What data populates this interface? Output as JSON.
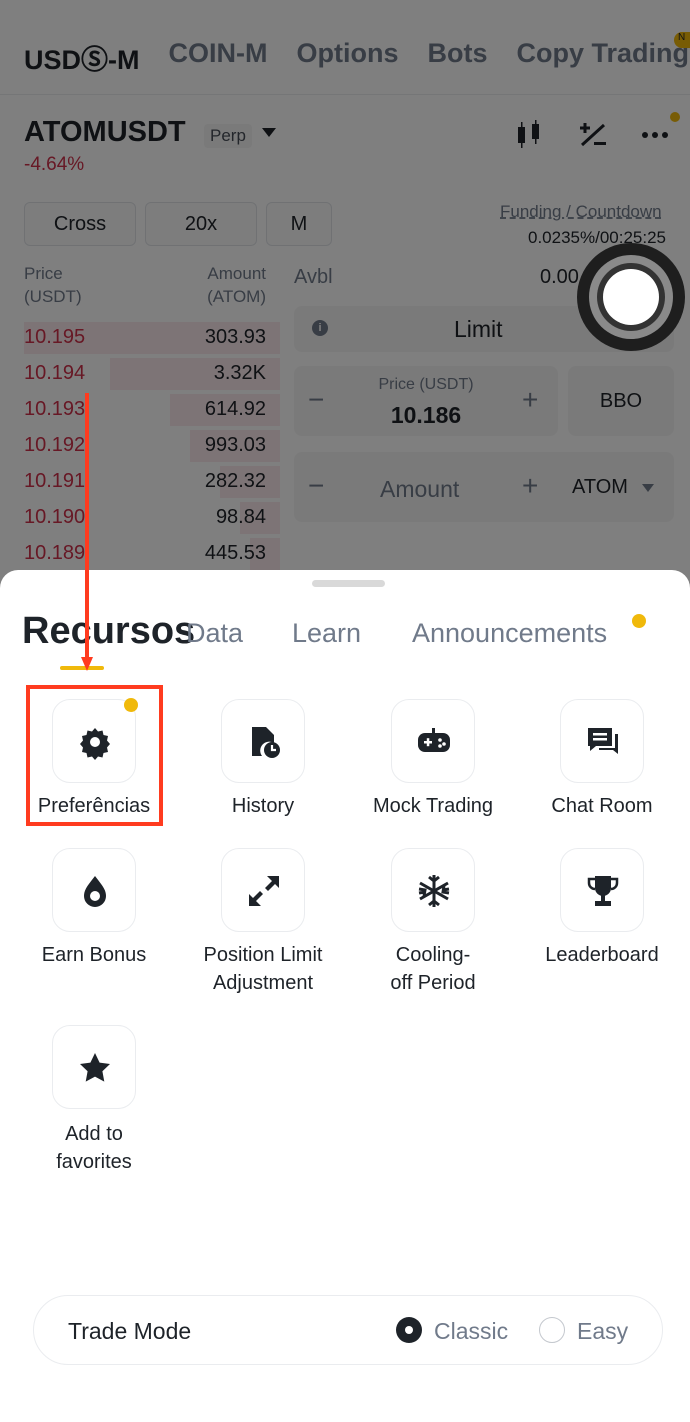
{
  "top_tabs": [
    "USDⓈ-M",
    "COIN-M",
    "Options",
    "Bots",
    "Copy Trading"
  ],
  "badge_new": "N",
  "header": {
    "symbol": "ATOMUSDT",
    "perp": "Perp",
    "change": "-4.64%"
  },
  "controls": {
    "margin_mode": "Cross",
    "leverage": "20x",
    "asset_mode": "M"
  },
  "funding": {
    "label": "Funding / Countdown",
    "value": "0.0235%/00:25:25"
  },
  "orderbook": {
    "price_header": "Price\n(USDT)",
    "amount_header": "Amount\n(ATOM)",
    "rows": [
      {
        "price": "10.195",
        "amount": "303.93"
      },
      {
        "price": "10.194",
        "amount": "3.32K"
      },
      {
        "price": "10.193",
        "amount": "614.92"
      },
      {
        "price": "10.192",
        "amount": "993.03"
      },
      {
        "price": "10.191",
        "amount": "282.32"
      },
      {
        "price": "10.190",
        "amount": "98.84"
      },
      {
        "price": "10.189",
        "amount": "445.53"
      }
    ]
  },
  "order_form": {
    "avbl_label": "Avbl",
    "avbl_value": "0.00",
    "order_type": "Limit",
    "price_label": "Price (USDT)",
    "price_value": "10.186",
    "bbo": "BBO",
    "amount_placeholder": "Amount",
    "amount_unit": "ATOM",
    "minus": "−",
    "plus": "+"
  },
  "sheet": {
    "tabs": [
      "Recursos",
      "Data",
      "Learn",
      "Announcements"
    ],
    "items": [
      {
        "label": "Preferências",
        "icon": "gear-icon"
      },
      {
        "label": "History",
        "icon": "history-icon"
      },
      {
        "label": "Mock Trading",
        "icon": "gamepad-icon"
      },
      {
        "label": "Chat Room",
        "icon": "chat-icon"
      },
      {
        "label": "Earn Bonus",
        "icon": "drop-icon"
      },
      {
        "label": "Position Limit Adjustment",
        "icon": "expand-icon"
      },
      {
        "label": "Cooling-off Period",
        "icon": "snowflake-icon"
      },
      {
        "label": "Leaderboard",
        "icon": "trophy-icon"
      },
      {
        "label": "Add to favorites",
        "icon": "star-icon"
      }
    ],
    "trade_mode": {
      "label": "Trade Mode",
      "options": [
        "Classic",
        "Easy"
      ],
      "selected": "Classic"
    }
  },
  "colors": {
    "accent": "#f0b90b",
    "sell": "#cf304a",
    "annotation": "#ff3b1f"
  }
}
